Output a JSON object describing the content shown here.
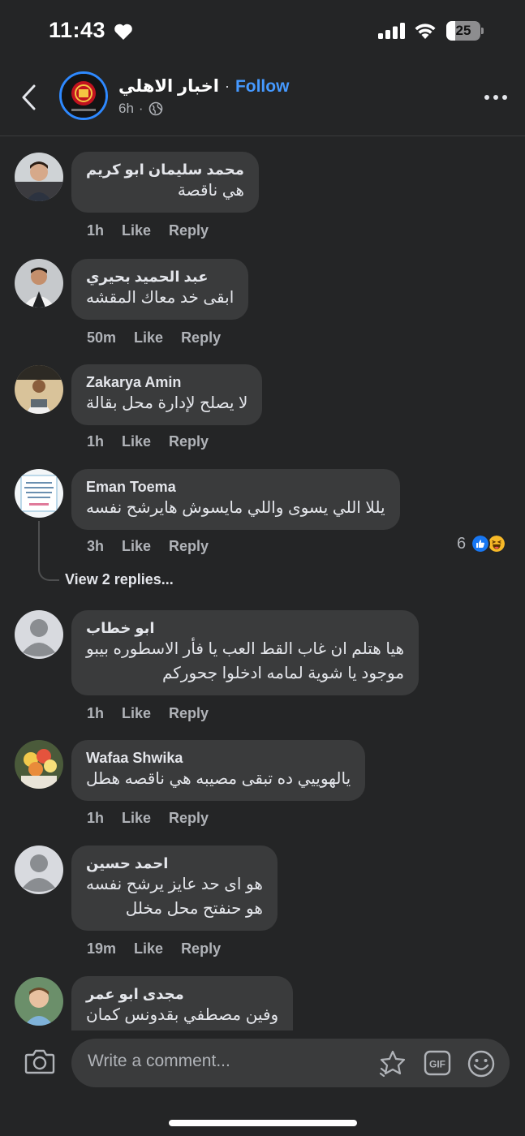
{
  "status_bar": {
    "time": "11:43",
    "battery": "25"
  },
  "header": {
    "page_name": "اخبار الاهلي",
    "separator": "·",
    "follow_label": "Follow",
    "post_age": "6h",
    "sub_separator": "·",
    "privacy_icon": "globe-icon"
  },
  "comments": [
    {
      "author": "محمد سليمان ابو كريم",
      "text": "هي ناقصة",
      "time": "1h",
      "like": "Like",
      "reply": "Reply"
    },
    {
      "author": "عبد الحميد بحيري",
      "text": "ابقى خد معاك المقشه",
      "time": "50m",
      "like": "Like",
      "reply": "Reply"
    },
    {
      "author": "Zakarya Amin",
      "text": "لا يصلح لإدارة محل بقالة",
      "time": "1h",
      "like": "Like",
      "reply": "Reply"
    },
    {
      "author": "Eman Toema",
      "text": "يللا اللي يسوى واللي مايسوش هايرشح نفسه",
      "time": "3h",
      "like": "Like",
      "reply": "Reply",
      "reaction_count": "6",
      "reaction_icons": [
        "like-reaction-icon",
        "haha-reaction-icon"
      ],
      "view_replies": "View 2 replies..."
    },
    {
      "author": "ابو خطاب",
      "text": "هيا هتلم ان غاب القط العب يا فأر الاسطوره بيبو\nموجود يا شوية لمامه ادخلوا جحوركم",
      "time": "1h",
      "like": "Like",
      "reply": "Reply"
    },
    {
      "author": "Wafaa Shwika",
      "text": "يالهوييي ده تبقى مصيبه هي ناقصه هطل",
      "time": "1h",
      "like": "Like",
      "reply": "Reply"
    },
    {
      "author": "احمد حسين",
      "text": "هو اى حد عايز يرشح نفسه\nهو حنفتح محل مخلل",
      "time": "19m",
      "like": "Like",
      "reply": "Reply"
    },
    {
      "author": "مجدى ابو عمر",
      "text": "وفين مصطفي بقدونس كمان",
      "time": "",
      "like": "",
      "reply": ""
    }
  ],
  "composer": {
    "placeholder": "Write a comment...",
    "icons": [
      "camera-icon",
      "sticker-icon",
      "gif-icon",
      "emoji-icon"
    ]
  },
  "colors": {
    "background": "#242526",
    "bubble": "#3a3b3c",
    "accent": "#4599ff",
    "muted": "#b0b3b8"
  }
}
